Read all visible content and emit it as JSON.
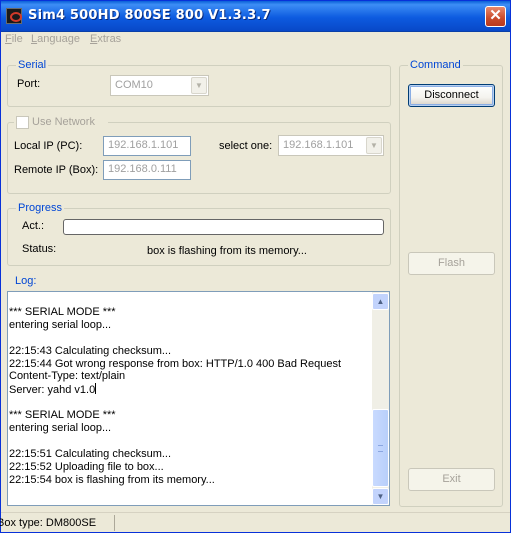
{
  "window": {
    "title": "Sim4 500HD 800SE 800 V1.3.3.7",
    "close_glyph": "✕"
  },
  "menu": [
    {
      "first": "F",
      "rest": "ile"
    },
    {
      "first": "L",
      "rest": "anguage"
    },
    {
      "first": "E",
      "rest": "xtras"
    }
  ],
  "serial": {
    "legend": "Serial",
    "port_label": "Port:",
    "port_value": "COM10"
  },
  "network": {
    "use_network_label": "Use Network",
    "local_ip_label": "Local IP (PC):",
    "local_ip_value": "192.168.1.101",
    "remote_ip_label": "Remote IP (Box):",
    "remote_ip_value": "192.168.0.111",
    "select_one_label": "select one:",
    "select_one_value": "192.168.1.101"
  },
  "progress": {
    "legend": "Progress",
    "act_label": "Act.:",
    "act_value": 0,
    "status_label": "Status:",
    "status_value": "box is flashing from its memory..."
  },
  "log": {
    "legend": "Log:",
    "lines": [
      "*** SERIAL MODE ***",
      "entering serial loop...",
      "",
      "22:15:43 Calculating checksum...",
      "22:15:44 Got wrong response from box: HTTP/1.0 400 Bad Request",
      "Content-Type: text/plain",
      "Server: yahd v1.0",
      "",
      "*** SERIAL MODE ***",
      "entering serial loop...",
      "",
      "22:15:51 Calculating checksum...",
      "22:15:52 Uploading file to box...",
      "22:15:54 box is flashing from its memory..."
    ]
  },
  "command": {
    "legend": "Command",
    "disconnect_label": "Disconnect",
    "flash_label": "Flash",
    "exit_label": "Exit"
  },
  "statusbar": {
    "box_type": "Box type: DM800SE"
  },
  "icons": {
    "dropdown": "chevron-down-icon",
    "scroll_up": "scroll-up-icon",
    "scroll_down": "scroll-down-icon"
  },
  "colors": {
    "titlebar": "#0a5fd8",
    "group_legend": "#0046d5",
    "window_bg": "#ece9d8",
    "close_button": "#c84a2a"
  }
}
